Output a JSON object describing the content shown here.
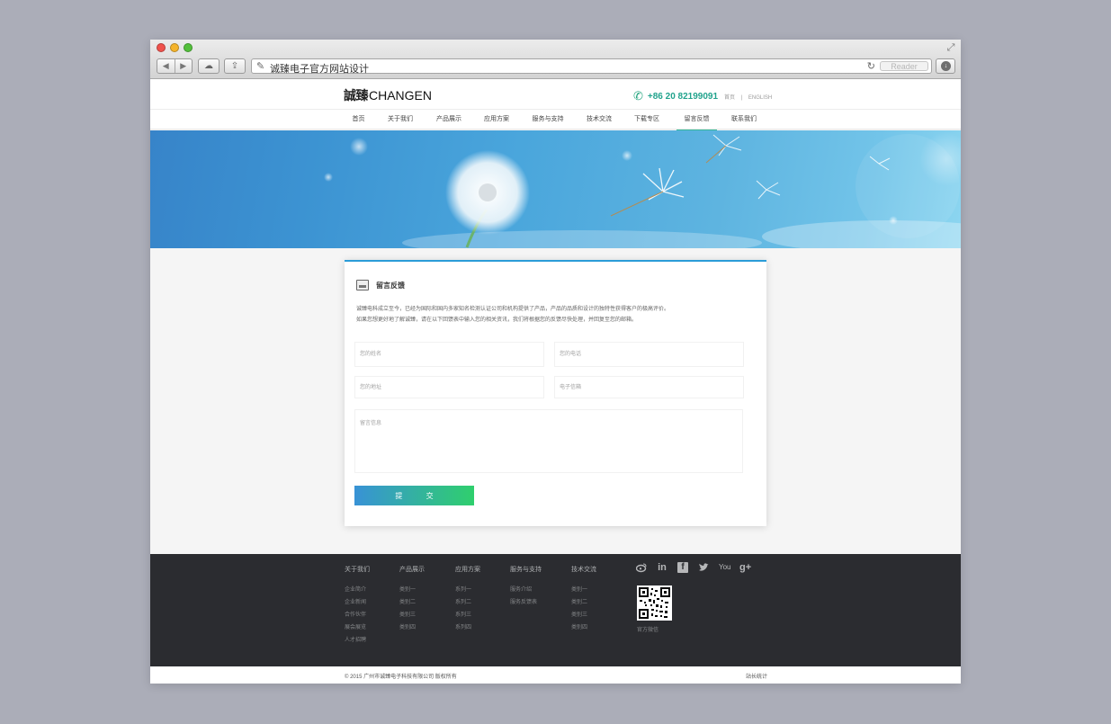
{
  "browser": {
    "url_text": "诚臻电子官方网站设计",
    "reader_label": "Reader",
    "back_glyph": "◀",
    "forward_glyph": "▶",
    "icons": [
      "back-icon",
      "forward-icon",
      "cloud-icon",
      "share-icon",
      "site-icon",
      "reload-icon",
      "download-icon",
      "fullscreen-icon"
    ]
  },
  "site": {
    "logo_cn": "誠臻",
    "logo_en": "CHANGEN",
    "phone": "+86 20 82199091",
    "lang_home": "首页",
    "lang_sep": "|",
    "lang_english": "ENGLISH",
    "nav": [
      "首页",
      "关于我们",
      "产品展示",
      "应用方案",
      "服务与支持",
      "技术交流",
      "下载专区",
      "留言反馈",
      "联系我们"
    ],
    "active_nav": "留言反馈"
  },
  "form": {
    "title": "留言反馈",
    "intro_1": "诚臻电科成立至今，已经为国际和国内多家知名检测认证公司和机构提供了产品，产品的品质和设计的独特性获得客户的极高评价。",
    "intro_2": "如果您想更好地了解诚臻，请在以下回馈表中输入您的相关资讯，我们将根据您的反馈尽快处理，并回复至您的邮箱。",
    "name_placeholder": "您的姓名",
    "phone_placeholder": "您的电话",
    "address_placeholder": "您的地址",
    "email_placeholder": "电子信箱",
    "message_placeholder": "留言信息",
    "submit_label": "提 交"
  },
  "footer": {
    "columns": [
      {
        "title": "关于我们",
        "links": [
          "企业简介",
          "企业新闻",
          "合作伙伴",
          "展会展览",
          "人才招聘"
        ]
      },
      {
        "title": "产品展示",
        "links": [
          "类别一",
          "类别二",
          "类别三",
          "类别四"
        ]
      },
      {
        "title": "应用方案",
        "links": [
          "系列一",
          "系列二",
          "系列三",
          "系列四"
        ]
      },
      {
        "title": "服务与支持",
        "links": [
          "服务介绍",
          "服务反馈表"
        ]
      },
      {
        "title": "技术交流",
        "links": [
          "类别一",
          "类别二",
          "类别三",
          "类别四"
        ]
      }
    ],
    "social_icons": [
      "weibo-icon",
      "linkedin-icon",
      "facebook-icon",
      "twitter-icon",
      "youtube-icon",
      "google-plus-icon"
    ],
    "social_glyphs": {
      "linkedin": "in",
      "facebook": "f",
      "youtube": "You",
      "google_plus": "g+"
    },
    "qr_label": "官方微信",
    "copyright": "© 2015 广州市诚臻电子科技有限公司  版权所有",
    "stats": "站长统计"
  },
  "colors": {
    "accent_green": "#2bb58a",
    "accent_blue": "#2b9cd8",
    "footer_bg": "#2b2c30",
    "submit_gradient": [
      "#3892d6",
      "#2fcf6d"
    ]
  }
}
